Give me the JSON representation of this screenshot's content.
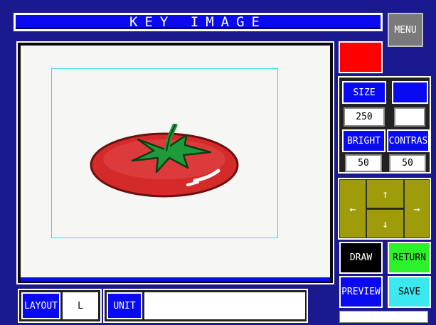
{
  "header": {
    "title": "KEY IMAGE",
    "menu_label": "MENU"
  },
  "canvas": {
    "image_name": "tomato-icon"
  },
  "colors": {
    "background": "#1a1a8e",
    "accent_blue": "#0a0af0",
    "selected_color": "#ff0000",
    "crop_box": "#38d8e8",
    "arrow_pad": "#9f9c0c",
    "return": "#2cf22c",
    "save": "#3ce8f0"
  },
  "settings": {
    "size_label": "SIZE",
    "size_value": "250",
    "size_extra_label": "",
    "size_extra_value": "",
    "bright_label": "BRIGHT",
    "bright_value": "50",
    "contrast_label": "CONTRAS",
    "contrast_value": "50"
  },
  "arrows": {
    "up": "↑",
    "down": "↓",
    "left": "←",
    "right": "→"
  },
  "actions": {
    "draw_label": "DRAW",
    "return_label": "RETURN",
    "preview_label": "PREVIEW",
    "save_label": "SAVE",
    "status_text": ""
  },
  "footer": {
    "layout_label": "LAYOUT",
    "layout_value": "L",
    "unit_label": "UNIT",
    "unit_value": ""
  }
}
